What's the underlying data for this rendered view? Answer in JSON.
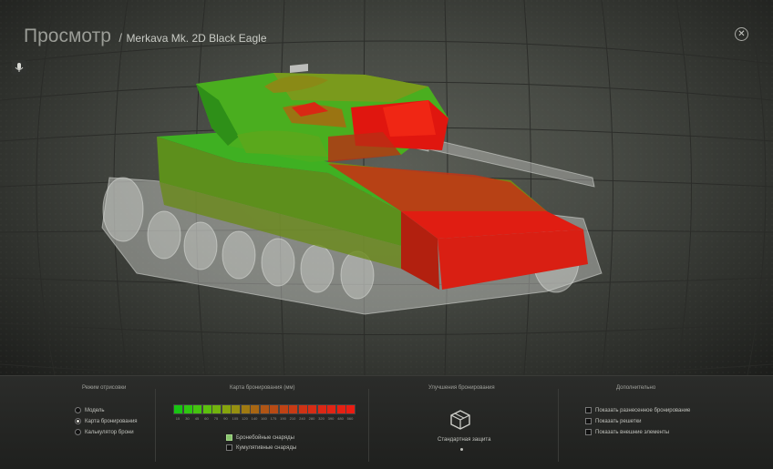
{
  "header": {
    "title": "Просмотр",
    "separator": "/",
    "vehicle_name": "Merkava Mk. 2D Black Eagle"
  },
  "controls": {
    "close_icon": "close-circle-icon",
    "mic_icon": "microphone-icon"
  },
  "render_mode": {
    "title": "Режим отрисовки",
    "options": [
      {
        "label": "Модель",
        "selected": false
      },
      {
        "label": "Карта бронирования",
        "selected": true
      },
      {
        "label": "Калькулятор брони",
        "selected": false
      }
    ]
  },
  "armor_map": {
    "title": "Карта бронирования (мм)",
    "scale_values": [
      "15",
      "30",
      "45",
      "60",
      "75",
      "90",
      "105",
      "120",
      "140",
      "160",
      "175",
      "190",
      "210",
      "240",
      "280",
      "320",
      "390",
      "480",
      "560"
    ],
    "scale_colors": [
      "#18c412",
      "#2ec610",
      "#44c40f",
      "#5cc00e",
      "#72b40e",
      "#86a40d",
      "#969010",
      "#a07a11",
      "#a86612",
      "#b05514",
      "#b84a14",
      "#c04214",
      "#c83a14",
      "#cf3214",
      "#d62c14",
      "#dc2714",
      "#e22414",
      "#e62012",
      "#ea1c12"
    ],
    "shell_options": [
      {
        "label": "Бронебойные снаряды",
        "checked": true
      },
      {
        "label": "Кумулятивные снаряды",
        "checked": false
      }
    ]
  },
  "armor_upgrades": {
    "title": "Улучшения бронирования",
    "item_label": "Стандартная защита",
    "item_icon": "armor-plate-icon"
  },
  "extra": {
    "title": "Дополнительно",
    "options": [
      {
        "label": "Показать разнесенное бронирование",
        "checked": false
      },
      {
        "label": "Показать решетки",
        "checked": false
      },
      {
        "label": "Показать внешние элементы",
        "checked": false
      }
    ]
  },
  "colors": {
    "armor_green": "#2fae1a",
    "armor_red": "#d81c14",
    "panel_bg": "#2b2c2a"
  }
}
